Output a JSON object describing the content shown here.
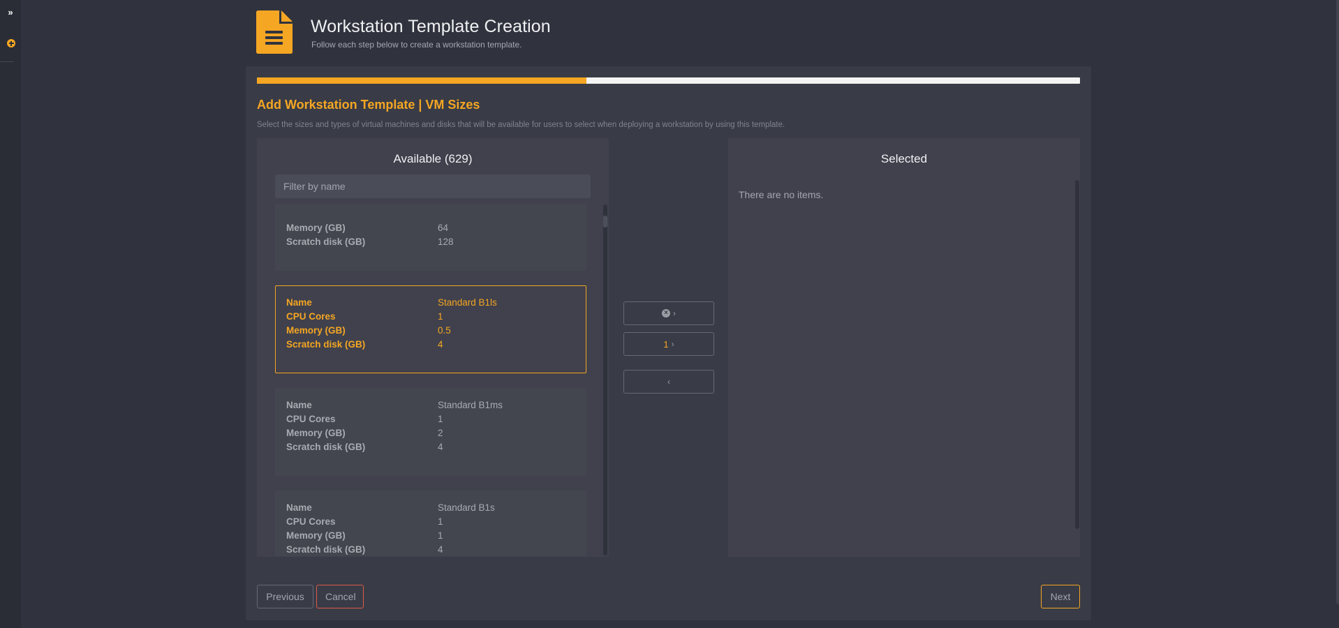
{
  "sidebar": {
    "expand_icon": "chevrons-right-icon",
    "add_icon": "plus-circle-icon"
  },
  "header": {
    "icon": "document-icon",
    "title": "Workstation Template Creation",
    "subtitle": "Follow each step below to create a workstation template."
  },
  "wizard": {
    "progress_percent": 40,
    "title": "Add Workstation Template | VM Sizes",
    "description": "Select the sizes and types of virtual machines and disks that will be available for users to select when deploying a workstation by using this template."
  },
  "available": {
    "title": "Available (629)",
    "filter_placeholder": "Filter by name",
    "filter_value": "",
    "items": [
      {
        "partial": true,
        "fields": [
          {
            "label": "Memory (GB)",
            "value": "64"
          },
          {
            "label": "Scratch disk (GB)",
            "value": "128"
          }
        ],
        "selected": false
      },
      {
        "fields": [
          {
            "label": "Name",
            "value": "Standard B1ls"
          },
          {
            "label": "CPU Cores",
            "value": "1"
          },
          {
            "label": "Memory (GB)",
            "value": "0.5"
          },
          {
            "label": "Scratch disk (GB)",
            "value": "4"
          }
        ],
        "selected": true
      },
      {
        "fields": [
          {
            "label": "Name",
            "value": "Standard B1ms"
          },
          {
            "label": "CPU Cores",
            "value": "1"
          },
          {
            "label": "Memory (GB)",
            "value": "2"
          },
          {
            "label": "Scratch disk (GB)",
            "value": "4"
          }
        ],
        "selected": false
      },
      {
        "fields": [
          {
            "label": "Name",
            "value": "Standard B1s"
          },
          {
            "label": "CPU Cores",
            "value": "1"
          },
          {
            "label": "Memory (GB)",
            "value": "1"
          },
          {
            "label": "Scratch disk (GB)",
            "value": "4"
          }
        ],
        "selected": false
      }
    ]
  },
  "transfer": {
    "clear_icon": "x-circle-icon",
    "move_chevron": "›",
    "selected_count": "1",
    "remove_chevron": "‹"
  },
  "selected": {
    "title": "Selected",
    "empty_text": "There are no items."
  },
  "footer": {
    "previous_label": "Previous",
    "cancel_label": "Cancel",
    "next_label": "Next"
  },
  "colors": {
    "accent": "#f5a623",
    "danger": "#e0584a",
    "background": "#30333d",
    "card": "#393c46",
    "panel": "#40414c"
  }
}
